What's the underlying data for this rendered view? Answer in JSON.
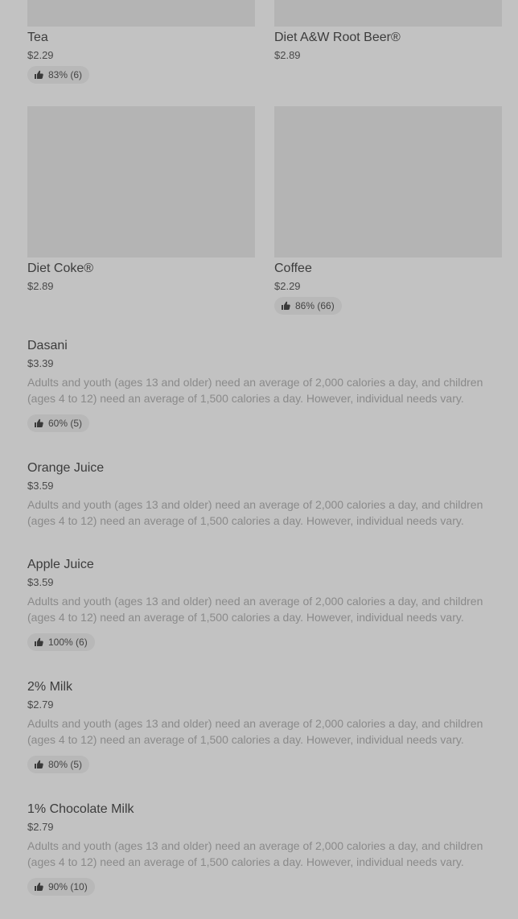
{
  "grid_items": [
    {
      "name": "Tea",
      "price": "$2.29",
      "rating": "83% (6)"
    },
    {
      "name": "Diet A&W Root Beer®",
      "price": "$2.89",
      "rating": ""
    },
    {
      "name": "Diet Coke®",
      "price": "$2.89",
      "rating": ""
    },
    {
      "name": "Coffee",
      "price": "$2.29",
      "rating": "86% (66)"
    }
  ],
  "list_items": [
    {
      "name": "Dasani",
      "price": "$3.39",
      "description": "Adults and youth (ages 13 and older) need an average of 2,000 calories a day, and children (ages 4 to 12) need an average of 1,500 calories a day. However, individual needs vary.",
      "rating": "60% (5)"
    },
    {
      "name": "Orange Juice",
      "price": "$3.59",
      "description": "Adults and youth (ages 13 and older) need an average of 2,000 calories a day, and children (ages 4 to 12) need an average of 1,500 calories a day. However, individual needs vary.",
      "rating": ""
    },
    {
      "name": "Apple Juice",
      "price": "$3.59",
      "description": "Adults and youth (ages 13 and older) need an average of 2,000 calories a day, and children (ages 4 to 12) need an average of 1,500 calories a day. However, individual needs vary.",
      "rating": "100% (6)"
    },
    {
      "name": "2% Milk",
      "price": "$2.79",
      "description": "Adults and youth (ages 13 and older) need an average of 2,000 calories a day, and children (ages 4 to 12) need an average of 1,500 calories a day. However, individual needs vary.",
      "rating": "80% (5)"
    },
    {
      "name": "1% Chocolate Milk",
      "price": "$2.79",
      "description": "Adults and youth (ages 13 and older) need an average of 2,000 calories a day, and children (ages 4 to 12) need an average of 1,500 calories a day. However, individual needs vary.",
      "rating": "90% (10)"
    }
  ],
  "icons": {
    "rating": "thumbs-up-icon"
  },
  "colors": {
    "overlay": "#c2c2c2",
    "image_placeholder": "#b4b4b4",
    "badge": "#b8b8b8"
  }
}
